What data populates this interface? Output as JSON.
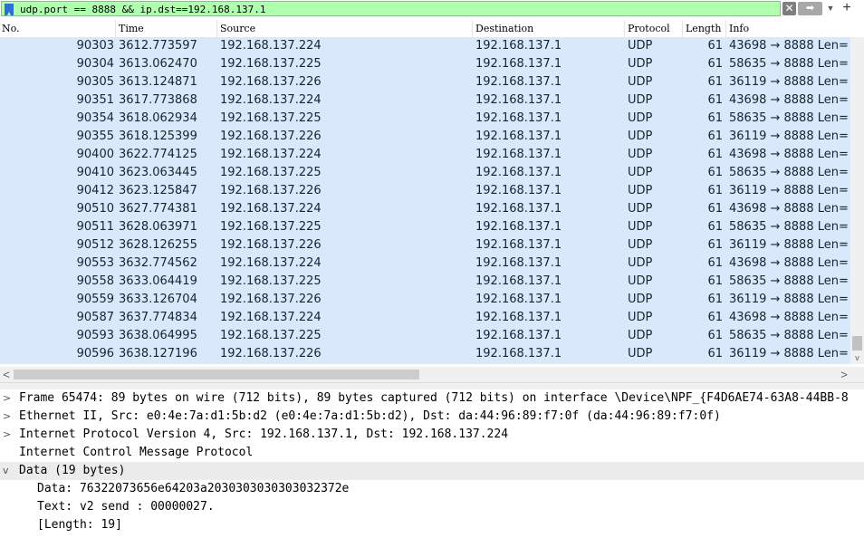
{
  "filter": {
    "text": "udp.port == 8888 && ip.dst==192.168.137.1",
    "clear_icon": "✕",
    "apply_icon": "➡",
    "recent_icon": "▼",
    "add_icon": "+"
  },
  "columns": {
    "no": "No.",
    "time": "Time",
    "source": "Source",
    "destination": "Destination",
    "protocol": "Protocol",
    "length": "Length",
    "info": "Info"
  },
  "packets": [
    {
      "no": "90303",
      "time": "3612.773597",
      "source": "192.168.137.224",
      "destination": "192.168.137.1",
      "protocol": "UDP",
      "length": "61",
      "info": "43698 → 8888 Len="
    },
    {
      "no": "90304",
      "time": "3613.062470",
      "source": "192.168.137.225",
      "destination": "192.168.137.1",
      "protocol": "UDP",
      "length": "61",
      "info": "58635 → 8888 Len="
    },
    {
      "no": "90305",
      "time": "3613.124871",
      "source": "192.168.137.226",
      "destination": "192.168.137.1",
      "protocol": "UDP",
      "length": "61",
      "info": "36119 → 8888 Len="
    },
    {
      "no": "90351",
      "time": "3617.773868",
      "source": "192.168.137.224",
      "destination": "192.168.137.1",
      "protocol": "UDP",
      "length": "61",
      "info": "43698 → 8888 Len="
    },
    {
      "no": "90354",
      "time": "3618.062934",
      "source": "192.168.137.225",
      "destination": "192.168.137.1",
      "protocol": "UDP",
      "length": "61",
      "info": "58635 → 8888 Len="
    },
    {
      "no": "90355",
      "time": "3618.125399",
      "source": "192.168.137.226",
      "destination": "192.168.137.1",
      "protocol": "UDP",
      "length": "61",
      "info": "36119 → 8888 Len="
    },
    {
      "no": "90400",
      "time": "3622.774125",
      "source": "192.168.137.224",
      "destination": "192.168.137.1",
      "protocol": "UDP",
      "length": "61",
      "info": "43698 → 8888 Len="
    },
    {
      "no": "90410",
      "time": "3623.063445",
      "source": "192.168.137.225",
      "destination": "192.168.137.1",
      "protocol": "UDP",
      "length": "61",
      "info": "58635 → 8888 Len="
    },
    {
      "no": "90412",
      "time": "3623.125847",
      "source": "192.168.137.226",
      "destination": "192.168.137.1",
      "protocol": "UDP",
      "length": "61",
      "info": "36119 → 8888 Len="
    },
    {
      "no": "90510",
      "time": "3627.774381",
      "source": "192.168.137.224",
      "destination": "192.168.137.1",
      "protocol": "UDP",
      "length": "61",
      "info": "43698 → 8888 Len="
    },
    {
      "no": "90511",
      "time": "3628.063971",
      "source": "192.168.137.225",
      "destination": "192.168.137.1",
      "protocol": "UDP",
      "length": "61",
      "info": "58635 → 8888 Len="
    },
    {
      "no": "90512",
      "time": "3628.126255",
      "source": "192.168.137.226",
      "destination": "192.168.137.1",
      "protocol": "UDP",
      "length": "61",
      "info": "36119 → 8888 Len="
    },
    {
      "no": "90553",
      "time": "3632.774562",
      "source": "192.168.137.224",
      "destination": "192.168.137.1",
      "protocol": "UDP",
      "length": "61",
      "info": "43698 → 8888 Len="
    },
    {
      "no": "90558",
      "time": "3633.064419",
      "source": "192.168.137.225",
      "destination": "192.168.137.1",
      "protocol": "UDP",
      "length": "61",
      "info": "58635 → 8888 Len="
    },
    {
      "no": "90559",
      "time": "3633.126704",
      "source": "192.168.137.226",
      "destination": "192.168.137.1",
      "protocol": "UDP",
      "length": "61",
      "info": "36119 → 8888 Len="
    },
    {
      "no": "90587",
      "time": "3637.774834",
      "source": "192.168.137.224",
      "destination": "192.168.137.1",
      "protocol": "UDP",
      "length": "61",
      "info": "43698 → 8888 Len="
    },
    {
      "no": "90593",
      "time": "3638.064995",
      "source": "192.168.137.225",
      "destination": "192.168.137.1",
      "protocol": "UDP",
      "length": "61",
      "info": "58635 → 8888 Len="
    },
    {
      "no": "90596",
      "time": "3638.127196",
      "source": "192.168.137.226",
      "destination": "192.168.137.1",
      "protocol": "UDP",
      "length": "61",
      "info": "36119 → 8888 Len="
    }
  ],
  "details": {
    "frame": "Frame 65474: 89 bytes on wire (712 bits), 89 bytes captured (712 bits) on interface \\Device\\NPF_{F4D6AE74-63A8-44BB-8",
    "ethernet": "Ethernet II, Src: e0:4e:7a:d1:5b:d2 (e0:4e:7a:d1:5b:d2), Dst: da:44:96:89:f7:0f (da:44:96:89:f7:0f)",
    "ip": "Internet Protocol Version 4, Src: 192.168.137.1, Dst: 192.168.137.224",
    "icmp": "Internet Control Message Protocol",
    "data": "Data (19 bytes)",
    "data_children": [
      "Data: 76322073656e64203a2030303030303032372e",
      "Text: v2 send : 00000027.",
      "[Length: 19]"
    ],
    "collapsed_icon": ">",
    "expanded_icon": "v"
  },
  "colors": {
    "filter_valid": "#afffaf",
    "row_background": "#dae8fc",
    "row_text": "#12272e"
  },
  "scroll_icons": {
    "left": "<",
    "right": ">",
    "down": "v"
  }
}
